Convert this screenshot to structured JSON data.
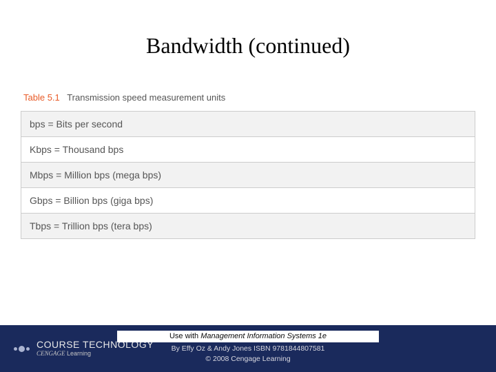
{
  "title": "Bandwidth (continued)",
  "table": {
    "label": "Table 5.1",
    "caption": "Transmission speed measurement units",
    "rows": [
      "bps = Bits per second",
      "Kbps = Thousand bps",
      "Mbps = Million bps (mega bps)",
      "Gbps = Billion bps (giga bps)",
      "Tbps = Trillion bps (tera bps)"
    ]
  },
  "footer": {
    "logo_main": "COURSE TECHNOLOGY",
    "logo_sub_brand": "CENGAGE",
    "logo_sub_word": " Learning",
    "use_prefix": "Use with ",
    "use_title": "Management Information Systems 1e",
    "byline": "By Effy Oz & Andy Jones ISBN 9781844807581",
    "copyright": "© 2008 Cengage Learning"
  }
}
